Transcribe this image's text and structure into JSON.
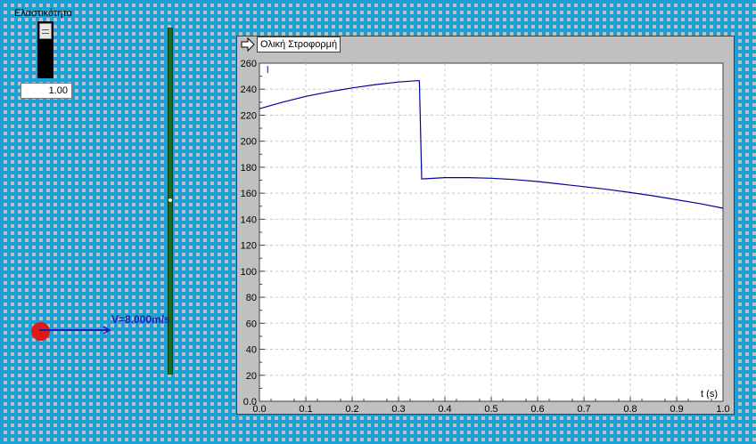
{
  "slider": {
    "label": "Ελαστικότητα",
    "value": "1.00",
    "fraction": 1.0
  },
  "ball": {
    "velocity_label": "V=8.000m/s",
    "color": "#e01818"
  },
  "graph": {
    "title": "Ολική Στροφορμή",
    "icon": "arrow-right-icon",
    "series_label": "l",
    "line_color": "#0000a0"
  },
  "chart_data": {
    "type": "line",
    "xlabel": "t (s)",
    "ylabel": "l",
    "xlim": [
      0,
      1.0
    ],
    "ylim": [
      0,
      260
    ],
    "xticks": [
      "0.0",
      "0.1",
      "0.2",
      "0.3",
      "0.4",
      "0.5",
      "0.6",
      "0.7",
      "0.8",
      "0.9",
      "1.0"
    ],
    "yticks": [
      "0.0",
      "20",
      "40",
      "60",
      "80",
      "100",
      "120",
      "140",
      "160",
      "180",
      "200",
      "220",
      "240",
      "260"
    ],
    "grid": true,
    "series": [
      {
        "x": [
          0.0,
          0.05,
          0.1,
          0.15,
          0.2,
          0.25,
          0.3,
          0.34,
          0.345,
          0.35,
          0.4,
          0.45,
          0.5,
          0.55,
          0.6,
          0.65,
          0.7,
          0.75,
          0.8,
          0.85,
          0.9,
          0.95,
          1.0
        ],
        "y": [
          225,
          230,
          234.5,
          238,
          241,
          243.5,
          245.5,
          246.5,
          246.5,
          171,
          172,
          172,
          171.5,
          170.5,
          169,
          167,
          165,
          163,
          160.5,
          158,
          155,
          152,
          148.5
        ]
      }
    ]
  }
}
